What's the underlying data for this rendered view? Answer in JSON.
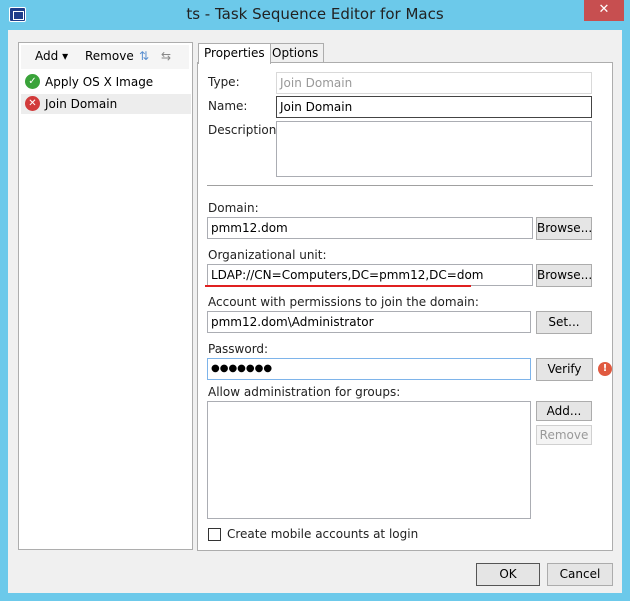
{
  "window": {
    "title": "ts - Task Sequence Editor for Macs",
    "close": "✕"
  },
  "toolbar": {
    "add": "Add",
    "remove": "Remove"
  },
  "steps": [
    {
      "label": "Apply OS X Image",
      "status": "success"
    },
    {
      "label": "Join Domain",
      "status": "error"
    }
  ],
  "tabs": [
    "Properties",
    "Options"
  ],
  "props": {
    "type_label": "Type:",
    "type_value": "Join Domain",
    "name_label": "Name:",
    "name_value": "Join Domain",
    "description_label": "Description:",
    "description_value": "",
    "domain_label": "Domain:",
    "domain_value": "pmm12.dom",
    "browse": "Browse...",
    "ou_label": "Organizational unit:",
    "ou_value": "LDAP://CN=Computers,DC=pmm12,DC=dom",
    "account_label": "Account with permissions to join the domain:",
    "account_value": "pmm12.dom\\Administrator",
    "set": "Set...",
    "password_label": "Password:",
    "password_value": "●●●●●●●",
    "verify": "Verify",
    "groups_label": "Allow administration for groups:",
    "add": "Add...",
    "remove": "Remove",
    "mobile_label": "Create mobile accounts at login",
    "mobile_checked": false
  },
  "footer": {
    "ok": "OK",
    "cancel": "Cancel"
  },
  "colors": {
    "frame": "#6cc9ea",
    "error_underline": "#e02020",
    "warning": "#e05a40"
  }
}
